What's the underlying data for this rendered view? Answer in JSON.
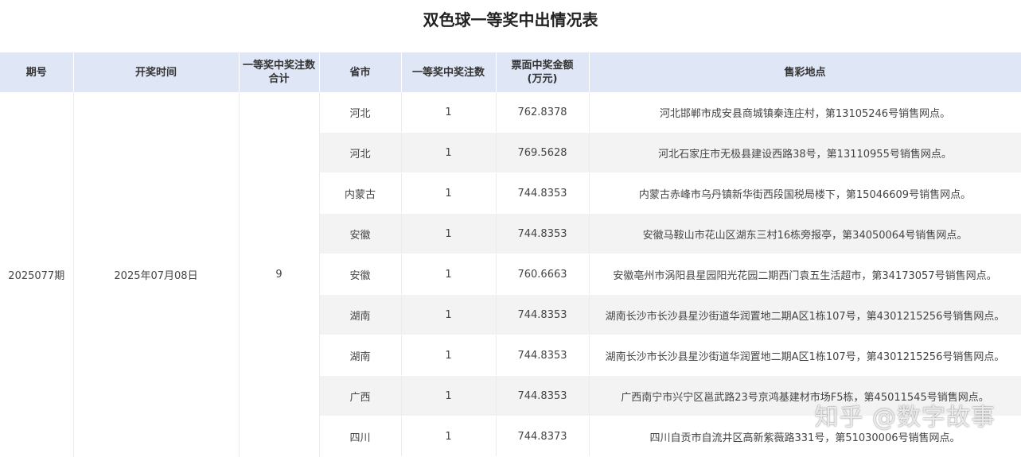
{
  "title": "双色球一等奖中出情况表",
  "headers": {
    "period": "期号",
    "draw_time": "开奖时间",
    "total_l1": "一等奖中奖注数",
    "total_l2": "合计",
    "province": "省市",
    "count": "一等奖中奖注数",
    "amount_l1": "票面中奖金额",
    "amount_l2": "(万元)",
    "location": "售彩地点"
  },
  "merged": {
    "period": "2025077期",
    "draw_time": "2025年07月08日",
    "total": "9"
  },
  "rows": [
    {
      "province": "河北",
      "count": "1",
      "amount": "762.8378",
      "location": "河北邯郸市成安县商城镇秦连庄村，第13105246号销售网点。"
    },
    {
      "province": "河北",
      "count": "1",
      "amount": "769.5628",
      "location": "河北石家庄市无极县建设西路38号，第13110955号销售网点。"
    },
    {
      "province": "内蒙古",
      "count": "1",
      "amount": "744.8353",
      "location": "内蒙古赤峰市乌丹镇新华街西段国税局楼下，第15046609号销售网点。"
    },
    {
      "province": "安徽",
      "count": "1",
      "amount": "744.8353",
      "location": "安徽马鞍山市花山区湖东三村16栋旁报亭，第34050064号销售网点。"
    },
    {
      "province": "安徽",
      "count": "1",
      "amount": "760.6663",
      "location": "安徽亳州市涡阳县星园阳光花园二期西门袁五生活超市，第34173057号销售网点。"
    },
    {
      "province": "湖南",
      "count": "1",
      "amount": "744.8353",
      "location": "湖南长沙市长沙县星沙街道华润置地二期A区1栋107号，第4301215256号销售网点。"
    },
    {
      "province": "湖南",
      "count": "1",
      "amount": "744.8353",
      "location": "湖南长沙市长沙县星沙街道华润置地二期A区1栋107号，第4301215256号销售网点。"
    },
    {
      "province": "广西",
      "count": "1",
      "amount": "744.8353",
      "location": "广西南宁市兴宁区邕武路23号京鸿基建材市场F5栋，第45011545号销售网点。"
    },
    {
      "province": "四川",
      "count": "1",
      "amount": "744.8373",
      "location": "四川自贡市自流井区高新紫薇路331号，第51030006号销售网点。"
    }
  ],
  "watermark": "知乎 @数字故事"
}
